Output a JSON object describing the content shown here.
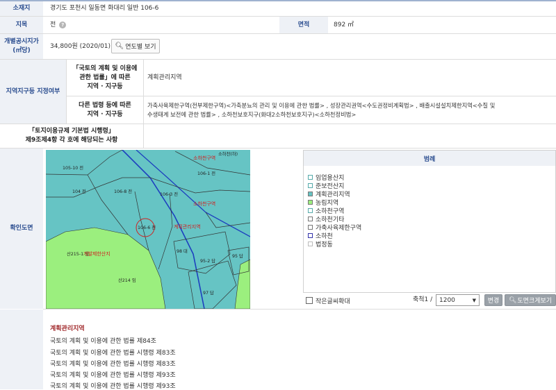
{
  "location": {
    "label": "소재지",
    "value": "경기도 포천시 일동면 화대리 일반 106-6"
  },
  "land": {
    "label": "지목",
    "value": "전",
    "help": "?",
    "area_label": "면적",
    "area_value": "892 ㎡"
  },
  "price": {
    "label_line1": "개별공시지가",
    "label_line2": "(㎡당)",
    "value": "34,800원 (2020/01)",
    "button": "연도별 보기"
  },
  "zoning": {
    "label": "지역지구등 지정여부",
    "row1_label_line1": "「국토의 계획 및 이용에",
    "row1_label_line2": "관한 법률」에 따른",
    "row1_label_line3": "지역 · 지구등",
    "row1_value": "계획관리지역",
    "row2_label_line1": "다른 법령 등에 따른",
    "row2_label_line2": "지역 · 지구등",
    "row2_value_line1": "가축사육제한구역(전부제한구역)<가축분뇨의 관리 및 이용에 관한 법률> , 성장관리권역<수도권정비계획법> , 배출시설설치제한지역<수질 및",
    "row2_value_line2": "수생태계 보전에 관한 법률> , 소하천보호지구(화대2소하천보호지구)<소하천정비법>"
  },
  "regulation": {
    "line1": "「토지이용규제 기본법 시행령」",
    "line2": "제9조제4항 각 호에 해당되는 사항"
  },
  "map": {
    "label": "확인도면",
    "parcels": [
      "105-10 전",
      "106-1 전",
      "106-8 전",
      "104 전",
      "106-3 전",
      "106-6 전",
      "98 대",
      "95-2 답",
      "95 답",
      "97 답",
      "산214 임",
      "산215-1 임",
      "소하천(하)"
    ],
    "zone_labels": [
      "소하천구역",
      "소하천구역",
      "계획관리지역",
      "개발제한산지"
    ]
  },
  "legend": {
    "title": "범례",
    "items": [
      {
        "label": "임업용산지",
        "color": "#ffffff"
      },
      {
        "label": "준보전산지",
        "color": "#ffffff"
      },
      {
        "label": "계획관리지역",
        "color": "#66c4c4"
      },
      {
        "label": "농림지역",
        "color": "#9bef7e"
      },
      {
        "label": "소하천구역",
        "color": "#ffffff"
      },
      {
        "label": "소하천기타",
        "color": "#ffffff"
      },
      {
        "label": "가축사육제한구역",
        "color": "#ffffff"
      },
      {
        "label": "소하천",
        "color": "#ffffff"
      },
      {
        "label": "법정동",
        "color": "#ffffff"
      }
    ]
  },
  "controls": {
    "small_text": "작은글씨확대",
    "scale_label": "축척1 /",
    "scale_value": "1200",
    "change_button": "변경",
    "zoom_button": "도면크게보기"
  },
  "laws": {
    "title": "계획관리지역",
    "items": [
      {
        "law": "국토의 계획 및 이용에 관한 법률",
        "article": "제84조"
      },
      {
        "law": "국토의 계획 및 이용에 관한 법률 시행령",
        "article": "제83조"
      },
      {
        "law": "국토의 계획 및 이용에 관한 법률 시행령",
        "article": "제83조"
      },
      {
        "law": "국토의 계획 및 이용에 관한 법률 시행령",
        "article": "제93조"
      },
      {
        "law": "국토의 계획 및 이용에 관한 법률 시행령",
        "article": "제93조"
      }
    ]
  },
  "colors": {
    "label_bg": "#eef1f6",
    "label_text": "#2a4d8f",
    "zone_planned": "#66c4c4",
    "zone_farm": "#9bef7e",
    "law_title": "#a0282a"
  }
}
